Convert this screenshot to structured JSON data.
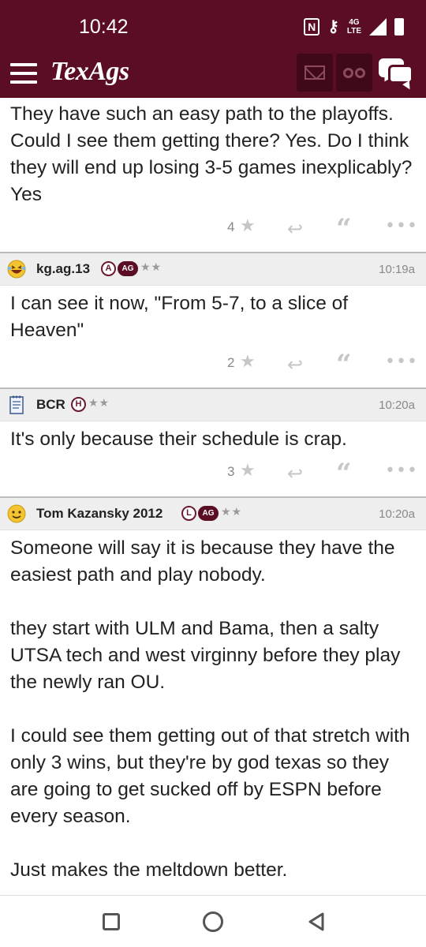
{
  "status_bar": {
    "time": "10:42",
    "nfc": "N",
    "network": "4G",
    "network_sub": "LTE"
  },
  "header": {
    "logo": "TexAgs",
    "icons": [
      "menu-icon",
      "mail-icon",
      "binoculars-icon",
      "chat-icon"
    ]
  },
  "posts": [
    {
      "body": [
        "They have such an easy path to the playoffs. Could I see them getting there? Yes. Do I think they will end up losing 3-5 games inexplicably? Yes"
      ],
      "likes": "4"
    },
    {
      "username": "kg.ag.13",
      "badges": [
        "A",
        "AG"
      ],
      "stars": "★★",
      "time": "10:19a",
      "avatar": "laughing-emoji-avatar",
      "body": [
        "I can see it now, \"From 5-7, to a slice of Heaven\""
      ],
      "likes": "2"
    },
    {
      "username": "BCR",
      "badges": [
        "H"
      ],
      "stars": "★★",
      "time": "10:20a",
      "avatar": "notepad-avatar",
      "body": [
        "It's only because their schedule is crap."
      ],
      "likes": "3"
    },
    {
      "username": "Tom Kazansky 2012",
      "badges": [
        "L",
        "AG"
      ],
      "stars": "★★",
      "time": "10:20a",
      "avatar": "smiley-emoji-avatar",
      "body": [
        "Someone will say it is because they have the easiest path and play nobody.",
        "they start with ULM and Bama, then a salty UTSA tech and west virginny before they play the newly ran OU.",
        "I could see them getting out of that stretch with only 3 wins, but they're by god texas so they are going to get sucked off by ESPN before every season.",
        "Just makes the meltdown better."
      ]
    }
  ],
  "colors": {
    "brand": "#5b0d24",
    "header_button": "#40091a",
    "post_header_bg": "#eeeeee"
  }
}
